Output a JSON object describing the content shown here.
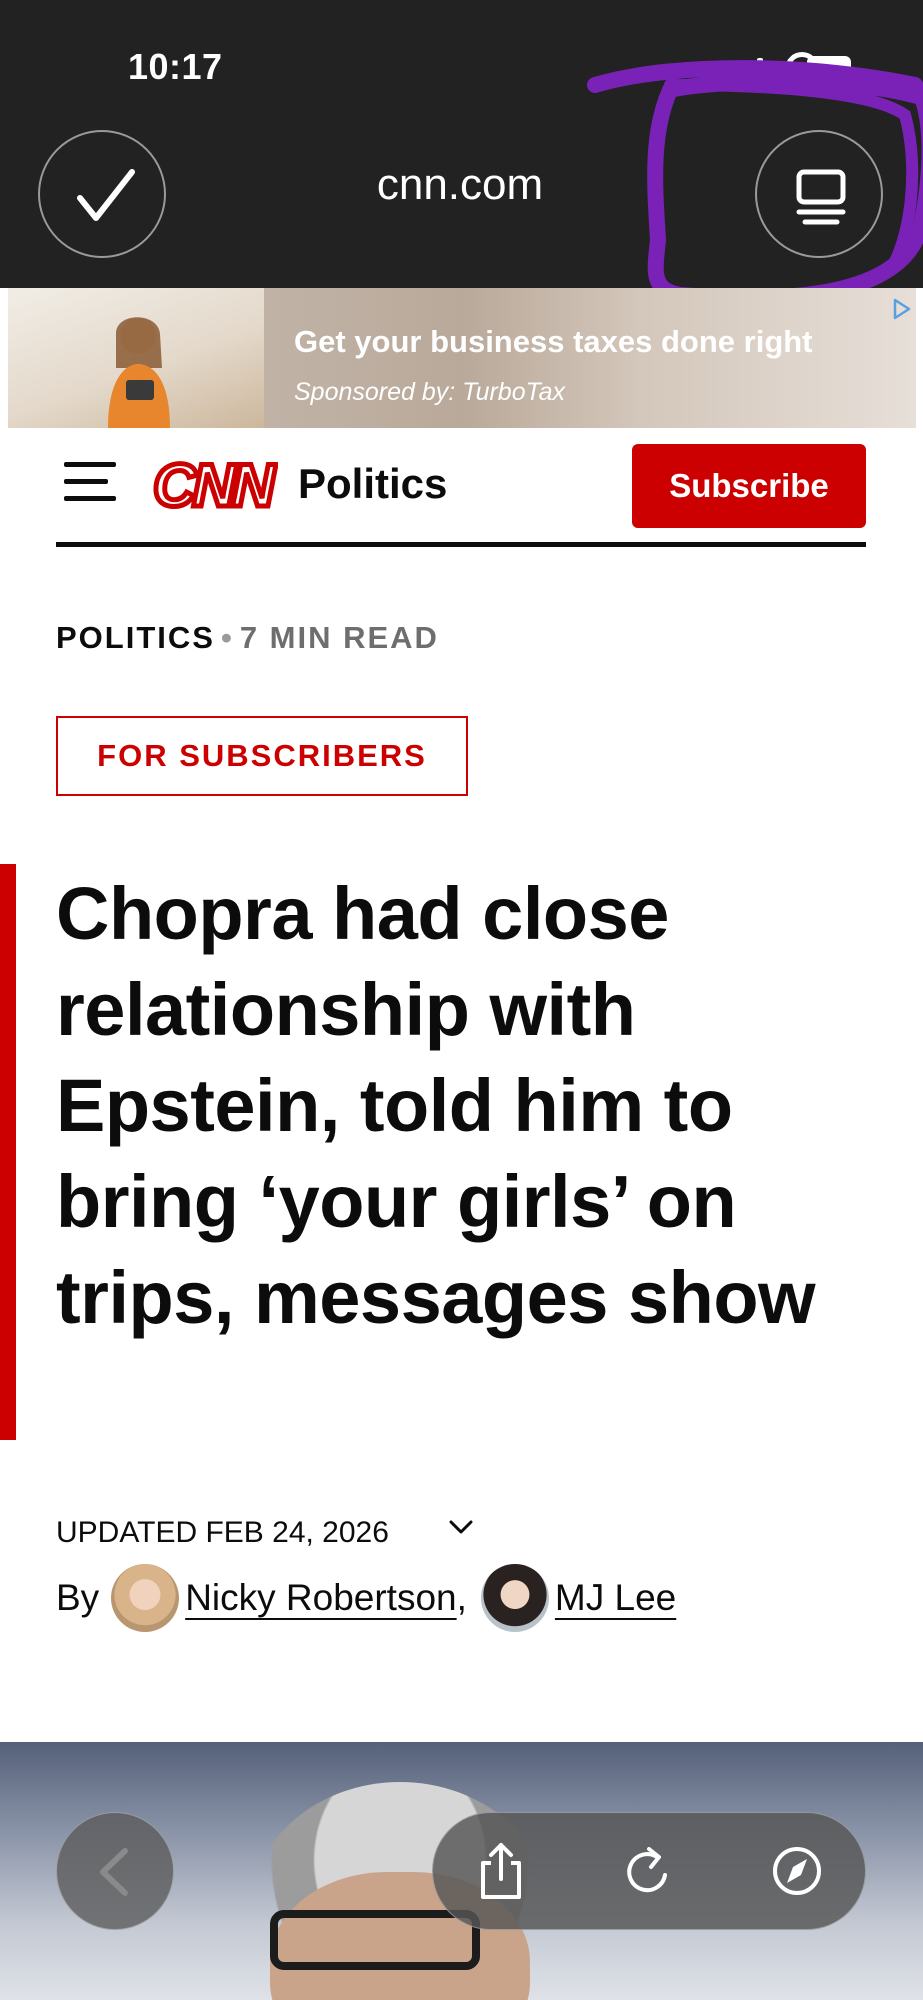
{
  "status_bar": {
    "time": "10:17"
  },
  "browser": {
    "url": "cnn.com",
    "check_icon": "checkmark-icon",
    "tabs_icon": "tab-overview-icon"
  },
  "ad": {
    "headline": "Get your business taxes done right",
    "sponsor": "Sponsored by: TurboTax",
    "choices_icon": "adchoices-icon"
  },
  "header": {
    "logo": "CNN",
    "section": "Politics",
    "subscribe_label": "Subscribe"
  },
  "article": {
    "category": "POLITICS",
    "read_time": "7 MIN READ",
    "badge": "FOR SUBSCRIBERS",
    "headline": "Chopra had close relationship with Epstein, told him to bring ‘your girls’ on trips, messages show",
    "updated": "UPDATED FEB 24, 2026",
    "by": "By",
    "authors": [
      "Nicky Robertson",
      "MJ Lee"
    ],
    "separator": ","
  },
  "colors": {
    "cnn_red": "#cc0000",
    "chrome_bg": "#222222",
    "annotation_purple": "#7a22b8"
  }
}
